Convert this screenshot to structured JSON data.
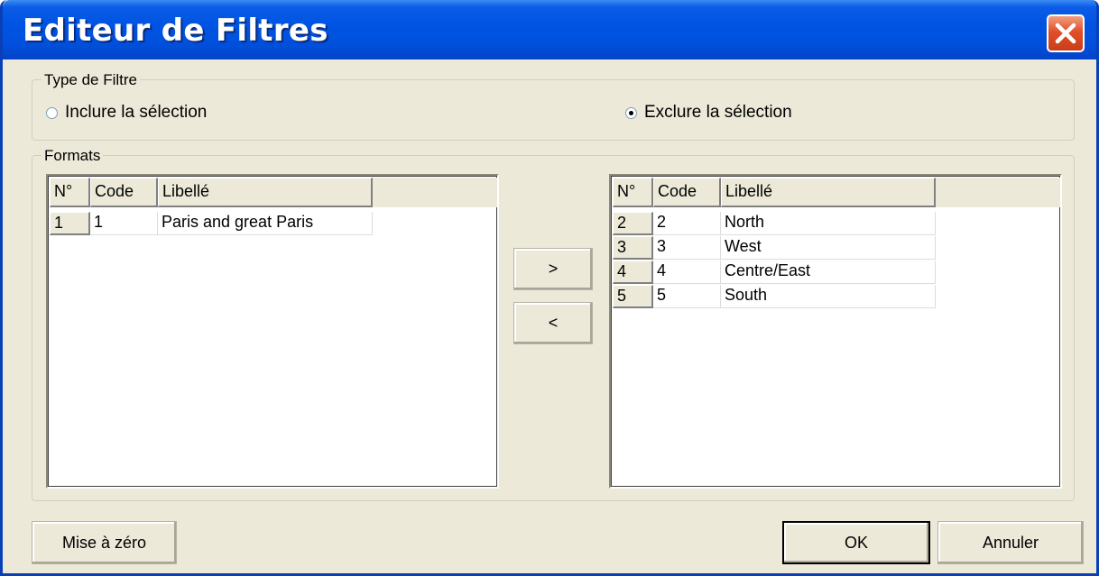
{
  "window": {
    "title": "Editeur de Filtres"
  },
  "filter_type": {
    "legend": "Type de Filtre",
    "include_label": "Inclure la sélection",
    "include_checked": false,
    "exclude_label": "Exclure la sélection",
    "exclude_checked": true
  },
  "formats": {
    "legend": "Formats",
    "left_grid": {
      "columns": [
        "N°",
        "Code",
        "Libellé"
      ],
      "rows": [
        {
          "n": "1",
          "code": "1",
          "label": "Paris and great Paris"
        }
      ]
    },
    "right_grid": {
      "columns": [
        "N°",
        "Code",
        "Libellé"
      ],
      "rows": [
        {
          "n": "2",
          "code": "2",
          "label": "North"
        },
        {
          "n": "3",
          "code": "3",
          "label": "West"
        },
        {
          "n": "4",
          "code": "4",
          "label": "Centre/East"
        },
        {
          "n": "5",
          "code": "5",
          "label": "South"
        }
      ]
    },
    "move_right_label": ">",
    "move_left_label": "<"
  },
  "buttons": {
    "reset_label": "Mise à zéro",
    "ok_label": "OK",
    "cancel_label": "Annuler"
  }
}
